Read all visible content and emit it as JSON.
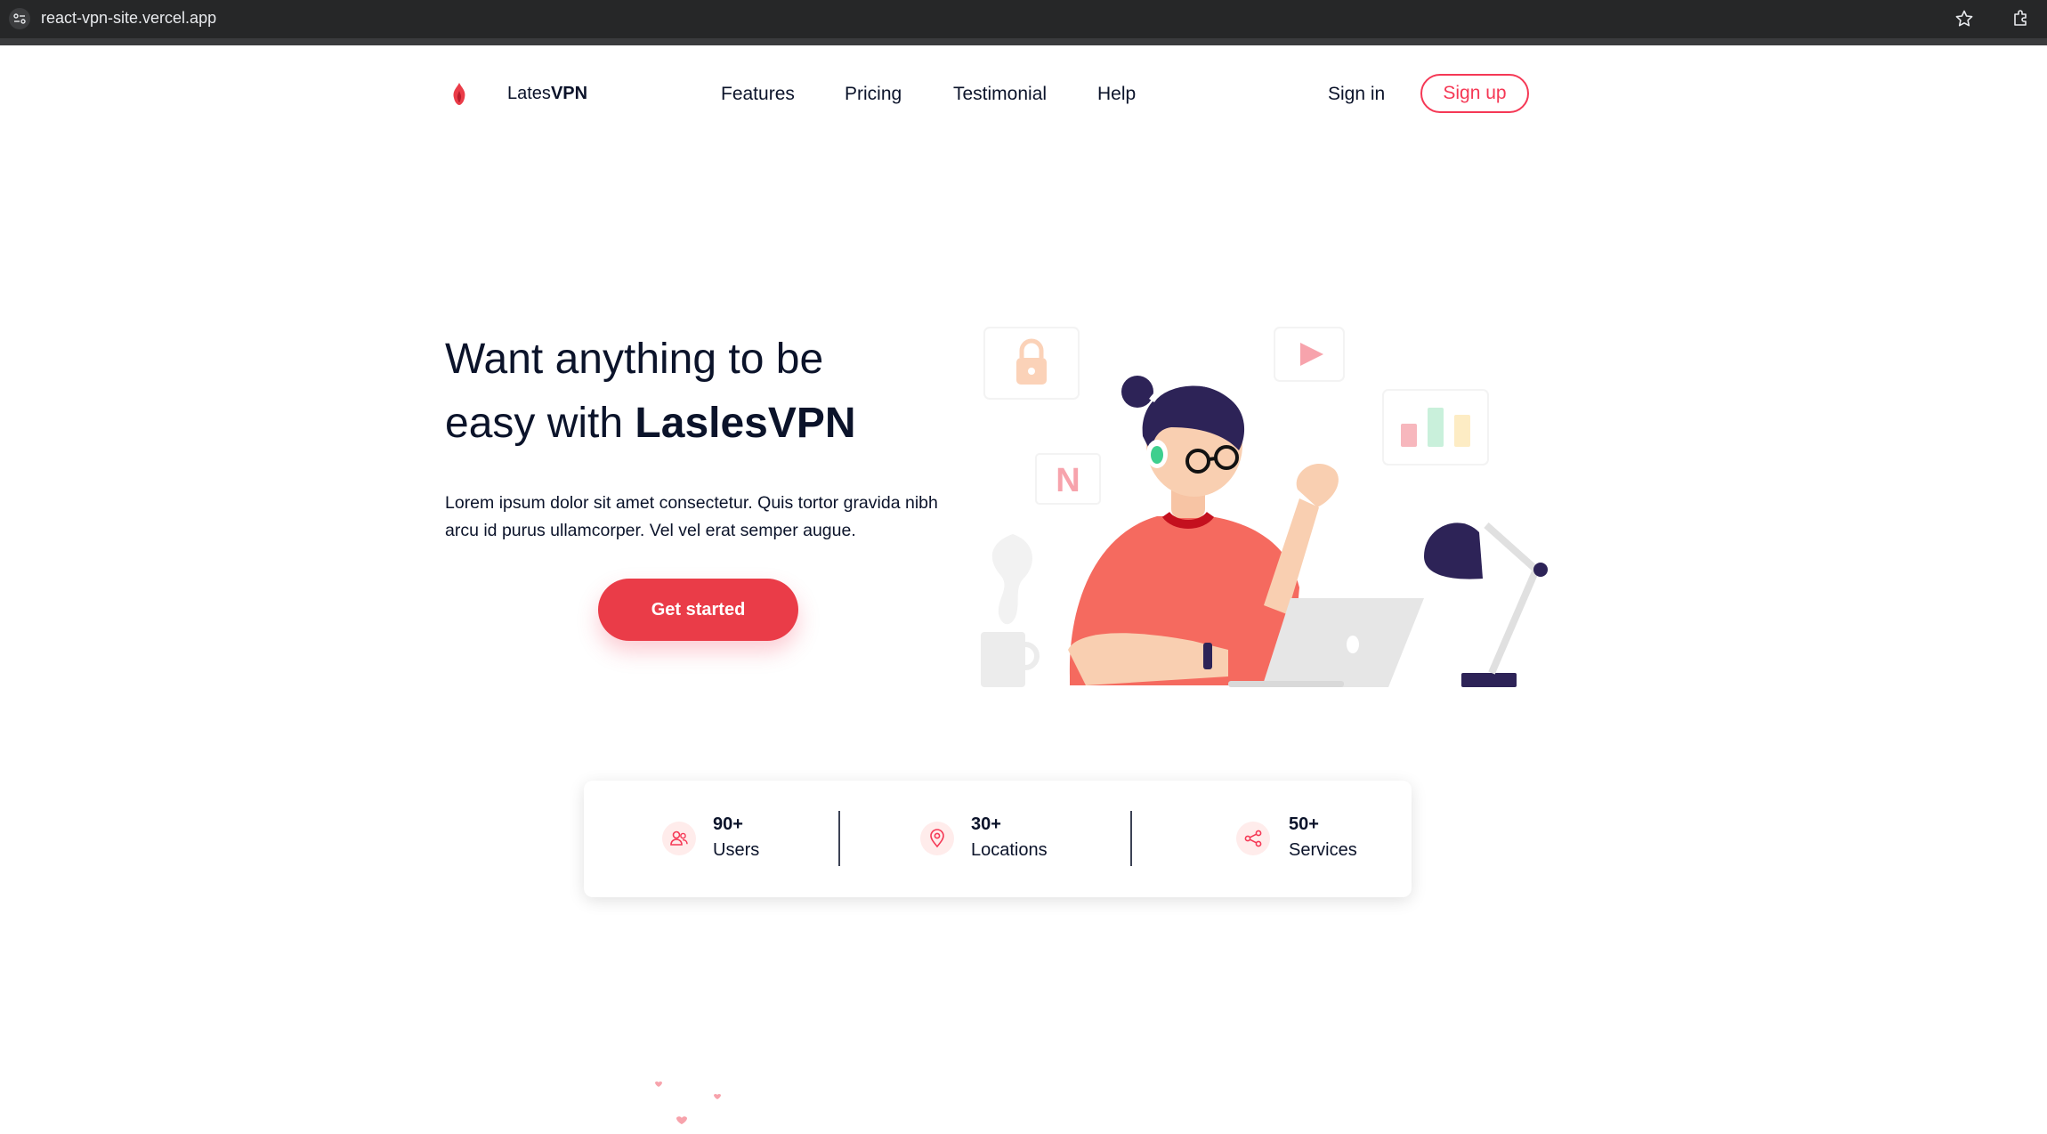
{
  "browser": {
    "url": "react-vpn-site.vercel.app",
    "icons": [
      "site-info-icon",
      "bookmark-star-icon",
      "extensions-icon"
    ]
  },
  "nav": {
    "brand_prefix": "Lates",
    "brand_bold": "VPN",
    "links": [
      "Features",
      "Pricing",
      "Testimonial",
      "Help"
    ],
    "sign_in": "Sign in",
    "sign_up": "Sign up"
  },
  "hero": {
    "title_line1": "Want anything to be",
    "title_line2_prefix": "easy with ",
    "title_brand": "LaslesVPN",
    "description": "Lorem ipsum dolor sit amet consectetur. Quis tortor gravida nibh arcu id purus ullamcorper. Vel vel erat semper augue.",
    "cta": "Get started"
  },
  "stats": [
    {
      "value": "90+",
      "label": "Users",
      "icon": "users-icon"
    },
    {
      "value": "30+",
      "label": "Locations",
      "icon": "location-pin-icon"
    },
    {
      "value": "50+",
      "label": "Services",
      "icon": "share-icon"
    }
  ],
  "colors": {
    "accent": "#f53855",
    "cta": "#ea3c48",
    "text": "#0b132a",
    "browser_bar": "#262728"
  }
}
